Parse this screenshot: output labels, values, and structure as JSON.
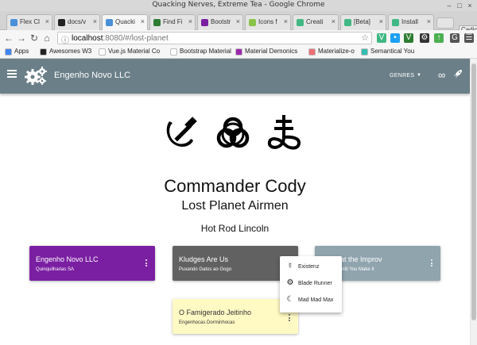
{
  "window": {
    "title": "Quacking Nerves, Extreme Tea - Google Chrome"
  },
  "tabs": [
    {
      "label": "Flex Cl",
      "favicon_color": "#4a90d9"
    },
    {
      "label": "docs/v",
      "favicon_color": "#222222"
    },
    {
      "label": "Quacki",
      "favicon_color": "#4a90d9",
      "active": true
    },
    {
      "label": "Find Fi",
      "favicon_color": "#2e7d32"
    },
    {
      "label": "Bootstr",
      "favicon_color": "#7b1fa2"
    },
    {
      "label": "Icons f",
      "favicon_color": "#8bc34a"
    },
    {
      "label": "Creati",
      "favicon_color": "#41b883"
    },
    {
      "label": "[Beta]",
      "favicon_color": "#41b883"
    },
    {
      "label": "Install",
      "favicon_color": "#41b883"
    }
  ],
  "profile_label": "Cadic",
  "address": {
    "host": "localhost",
    "path": ":8080/#/lost-planet"
  },
  "extensions": [
    {
      "icon": "V",
      "color": "#41b883"
    },
    {
      "icon": "•",
      "color": "#1da1f2"
    },
    {
      "icon": "V",
      "color": "#2e7d32"
    },
    {
      "icon": "⚙",
      "color": "#333333"
    },
    {
      "icon": "↑",
      "color": "#4caf50"
    },
    {
      "icon": "G",
      "color": "#555555"
    },
    {
      "icon": "☰",
      "color": "#555555"
    }
  ],
  "bookmarks": [
    {
      "label": "Apps",
      "color": "#4285f4"
    },
    {
      "label": "Awesomes W3",
      "color": "#222222"
    },
    {
      "label": "Vue.js Material Co",
      "color": "#ffffff"
    },
    {
      "label": "Bootstrap Material",
      "color": "#ffffff"
    },
    {
      "label": "Material Demonics",
      "color": "#9c27b0"
    },
    {
      "label": "Materialize-o",
      "color": "#ee6e73"
    },
    {
      "label": "Semantical You",
      "color": "#35bdb2"
    }
  ],
  "appbar": {
    "brand": "Engenho Novo LLC",
    "genres_label": "GENRES",
    "infinity_icon": "∞",
    "rocket_icon": "🚀"
  },
  "hero": {
    "name": "Commander Cody",
    "album": "Lost Planet Airmen",
    "song": "Hot Rod Lincoln"
  },
  "cards": [
    {
      "title": "Engenho Novo LLC",
      "subtitle": "Quinquilharias SA",
      "color": "#7b1fa2"
    },
    {
      "title": "Kludges Are Us",
      "subtitle": "Puxando Gatos ao Gogo",
      "color": "#616161"
    },
    {
      "title": "at the Improv",
      "subtitle": "ntil You Make It",
      "color": "#90a4ae"
    },
    {
      "title": "O Famigerado Jeitinho",
      "subtitle": "Engenhocas Dorminhocas",
      "color": "#fff9c4"
    }
  ],
  "menu": [
    {
      "label": "Existenz",
      "icon": "☿"
    },
    {
      "label": "Blade Runner",
      "icon": "⚙"
    },
    {
      "label": "Mad Mad Max",
      "icon": "☾"
    }
  ]
}
